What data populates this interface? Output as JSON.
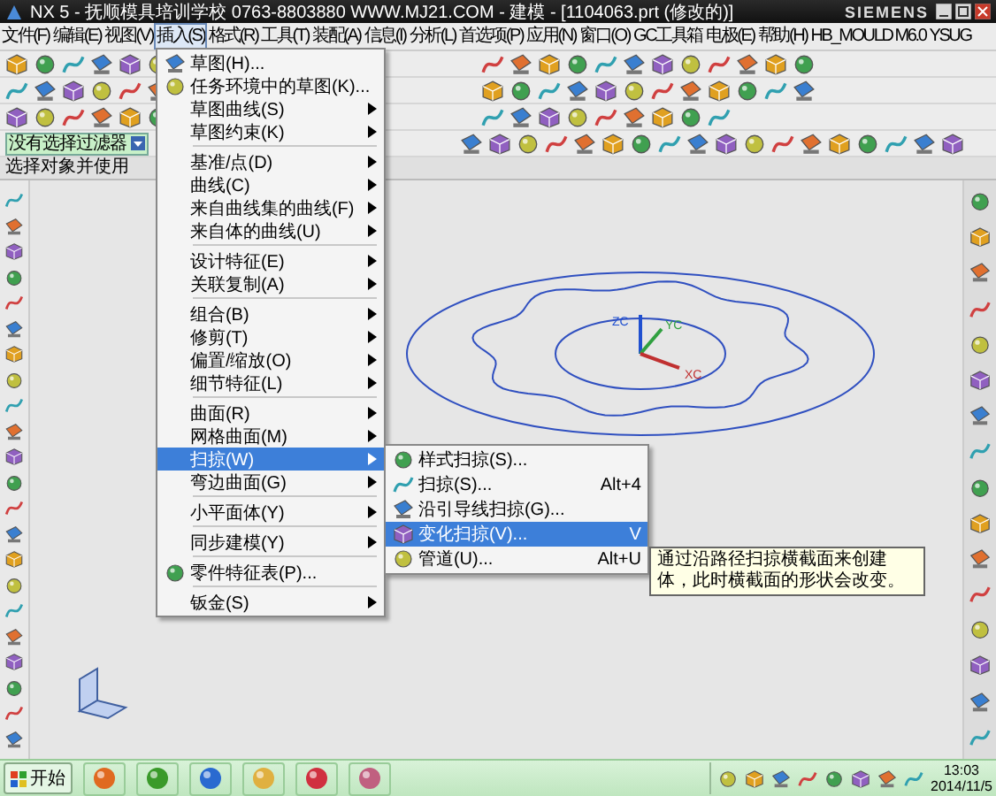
{
  "window": {
    "title": "NX 5 - 抚顺模具培训学校 0763-8803880 WWW.MJ21.COM - 建模 - [1104063.prt (修改的)]",
    "brand": "SIEMENS"
  },
  "menu_bar": [
    {
      "label": "文件(F)",
      "selected": false
    },
    {
      "label": "编辑(E)",
      "selected": false
    },
    {
      "label": "视图(V)",
      "selected": false
    },
    {
      "label": "插入(S)",
      "selected": true
    },
    {
      "label": "格式(R)",
      "selected": false
    },
    {
      "label": "工具(T)",
      "selected": false
    },
    {
      "label": "装配(A)",
      "selected": false
    },
    {
      "label": "信息(I)",
      "selected": false
    },
    {
      "label": "分析(L)",
      "selected": false
    },
    {
      "label": "首选项(P)",
      "selected": false
    },
    {
      "label": "应用(N)",
      "selected": false
    },
    {
      "label": "窗口(O)",
      "selected": false
    },
    {
      "label": "GC工具箱",
      "selected": false
    },
    {
      "label": "电极(E)",
      "selected": false
    },
    {
      "label": "帮助(H)",
      "selected": false
    },
    {
      "label": "HB_MOULD M6.0",
      "selected": false
    },
    {
      "label": "YSUG",
      "selected": false
    }
  ],
  "selection_bar": {
    "filter": "没有选择过滤器"
  },
  "status_line": "选择对象并使用",
  "insert_menu": [
    {
      "kind": "action",
      "label": "草图(H)...",
      "selected": false
    },
    {
      "kind": "action",
      "label": "任务环境中的草图(K)...",
      "selected": false
    },
    {
      "kind": "submenu",
      "label": "草图曲线(S)",
      "selected": false
    },
    {
      "kind": "submenu",
      "label": "草图约束(K)",
      "selected": false
    },
    {
      "kind": "separator"
    },
    {
      "kind": "submenu",
      "label": "基准/点(D)",
      "selected": false
    },
    {
      "kind": "submenu",
      "label": "曲线(C)",
      "selected": false
    },
    {
      "kind": "submenu",
      "label": "来自曲线集的曲线(F)",
      "selected": false
    },
    {
      "kind": "submenu",
      "label": "来自体的曲线(U)",
      "selected": false
    },
    {
      "kind": "separator"
    },
    {
      "kind": "submenu",
      "label": "设计特征(E)",
      "selected": false
    },
    {
      "kind": "submenu",
      "label": "关联复制(A)",
      "selected": false
    },
    {
      "kind": "separator"
    },
    {
      "kind": "submenu",
      "label": "组合(B)",
      "selected": false
    },
    {
      "kind": "submenu",
      "label": "修剪(T)",
      "selected": false
    },
    {
      "kind": "submenu",
      "label": "偏置/缩放(O)",
      "selected": false
    },
    {
      "kind": "submenu",
      "label": "细节特征(L)",
      "selected": false
    },
    {
      "kind": "separator"
    },
    {
      "kind": "submenu",
      "label": "曲面(R)",
      "selected": false
    },
    {
      "kind": "submenu",
      "label": "网格曲面(M)",
      "selected": false
    },
    {
      "kind": "submenu",
      "label": "扫掠(W)",
      "selected": true
    },
    {
      "kind": "submenu",
      "label": "弯边曲面(G)",
      "selected": false
    },
    {
      "kind": "separator"
    },
    {
      "kind": "submenu",
      "label": "小平面体(Y)",
      "selected": false
    },
    {
      "kind": "separator"
    },
    {
      "kind": "submenu",
      "label": "同步建模(Y)",
      "selected": false
    },
    {
      "kind": "separator"
    },
    {
      "kind": "action",
      "label": "零件特征表(P)...",
      "selected": false
    },
    {
      "kind": "separator"
    },
    {
      "kind": "submenu",
      "label": "钣金(S)",
      "selected": false
    }
  ],
  "sweep_submenu": [
    {
      "label": "样式扫掠(S)...",
      "selected": false
    },
    {
      "label": "扫掠(S)...",
      "shortcut": "Alt+4",
      "selected": false
    },
    {
      "label": "沿引导线扫掠(G)...",
      "selected": false
    },
    {
      "label": "变化扫掠(V)...",
      "shortcut": "V",
      "selected": true
    },
    {
      "label": "管道(U)...",
      "shortcut": "Alt+U",
      "selected": false
    }
  ],
  "tooltip": "通过沿路径扫掠横截面来创建体，此时横截面的形状会改变。",
  "triad_labels": [
    "ZC",
    "YC",
    "XC"
  ],
  "taskbar": {
    "start": "开始",
    "time": "13:03",
    "date": "2014/11/5"
  }
}
